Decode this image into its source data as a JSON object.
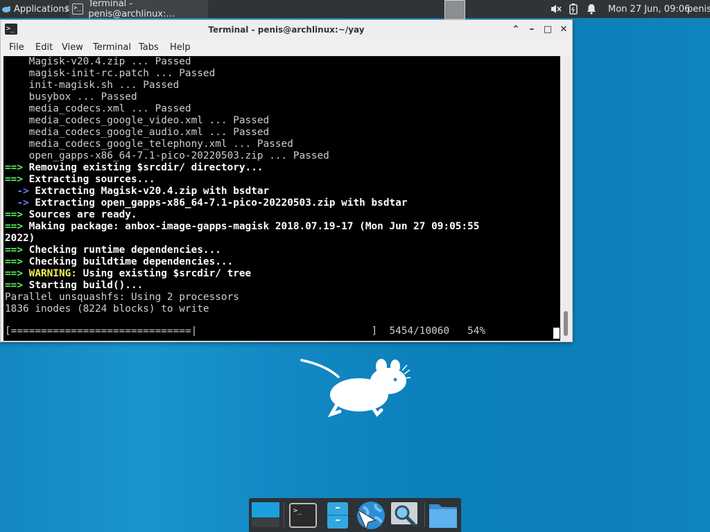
{
  "top_panel": {
    "applications_label": "Applications",
    "separator": "⠿",
    "taskbar_terminal_label": "Terminal - penis@archlinux:...",
    "clock": "Mon 27 Jun, 09:06",
    "user": "penis"
  },
  "window": {
    "title": "Terminal - penis@archlinux:~/yay",
    "buttons": {
      "shade": "⌃",
      "minimize": "–",
      "maximize": "□",
      "close": "✕"
    }
  },
  "menubar": {
    "file": "File",
    "edit": "Edit",
    "view": "View",
    "terminal": "Terminal",
    "tabs": "Tabs",
    "help": "Help"
  },
  "terminal": {
    "lines": [
      {
        "text": "    Magisk-v20.4.zip ... Passed"
      },
      {
        "text": "    magisk-init-rc.patch ... Passed"
      },
      {
        "text": "    init-magisk.sh ... Passed"
      },
      {
        "text": "    busybox ... Passed"
      },
      {
        "text": "    media_codecs.xml ... Passed"
      },
      {
        "text": "    media_codecs_google_video.xml ... Passed"
      },
      {
        "text": "    media_codecs_google_audio.xml ... Passed"
      },
      {
        "text": "    media_codecs_google_telephony.xml ... Passed"
      },
      {
        "text": "    open_gapps-x86_64-7.1-pico-20220503.zip ... Passed"
      },
      {
        "prefix": "==> ",
        "prefix_color": "green",
        "text": "Removing existing $srcdir/ directory..."
      },
      {
        "prefix": "==> ",
        "prefix_color": "green",
        "text": "Extracting sources..."
      },
      {
        "prefix": "  -> ",
        "prefix_color": "blue",
        "text": "Extracting Magisk-v20.4.zip with bsdtar"
      },
      {
        "prefix": "  -> ",
        "prefix_color": "blue",
        "text": "Extracting open_gapps-x86_64-7.1-pico-20220503.zip with bsdtar"
      },
      {
        "prefix": "==> ",
        "prefix_color": "green",
        "text": "Sources are ready."
      },
      {
        "prefix": "==> ",
        "prefix_color": "green",
        "text": "Making package: anbox-image-gapps-magisk 2018.07.19-17 (Mon Jun 27 09:05:55"
      },
      {
        "bold": true,
        "text": "2022)"
      },
      {
        "prefix": "==> ",
        "prefix_color": "green",
        "text": "Checking runtime dependencies..."
      },
      {
        "prefix": "==> ",
        "prefix_color": "green",
        "text": "Checking buildtime dependencies..."
      },
      {
        "prefix": "==> ",
        "prefix_color": "green",
        "warn": "WARNING:",
        "text": " Using existing $srcdir/ tree"
      },
      {
        "prefix": "==> ",
        "prefix_color": "green",
        "text": "Starting build()..."
      },
      {
        "text": "Parallel unsquashfs: Using 2 processors"
      },
      {
        "text": "1836 inodes (8224 blocks) to write"
      }
    ],
    "progress_bar": "[==============================|                             ]  5454/10060   54%"
  },
  "dock": {
    "items": [
      "show-desktop",
      "terminal",
      "file-manager",
      "web-browser",
      "app-finder",
      "home-folder"
    ]
  },
  "colors": {
    "prompt_green": "#5af75a",
    "arrow_blue": "#6a78ff",
    "warning_yellow": "#f0f05a",
    "desktop_blue": "#1487c2"
  }
}
